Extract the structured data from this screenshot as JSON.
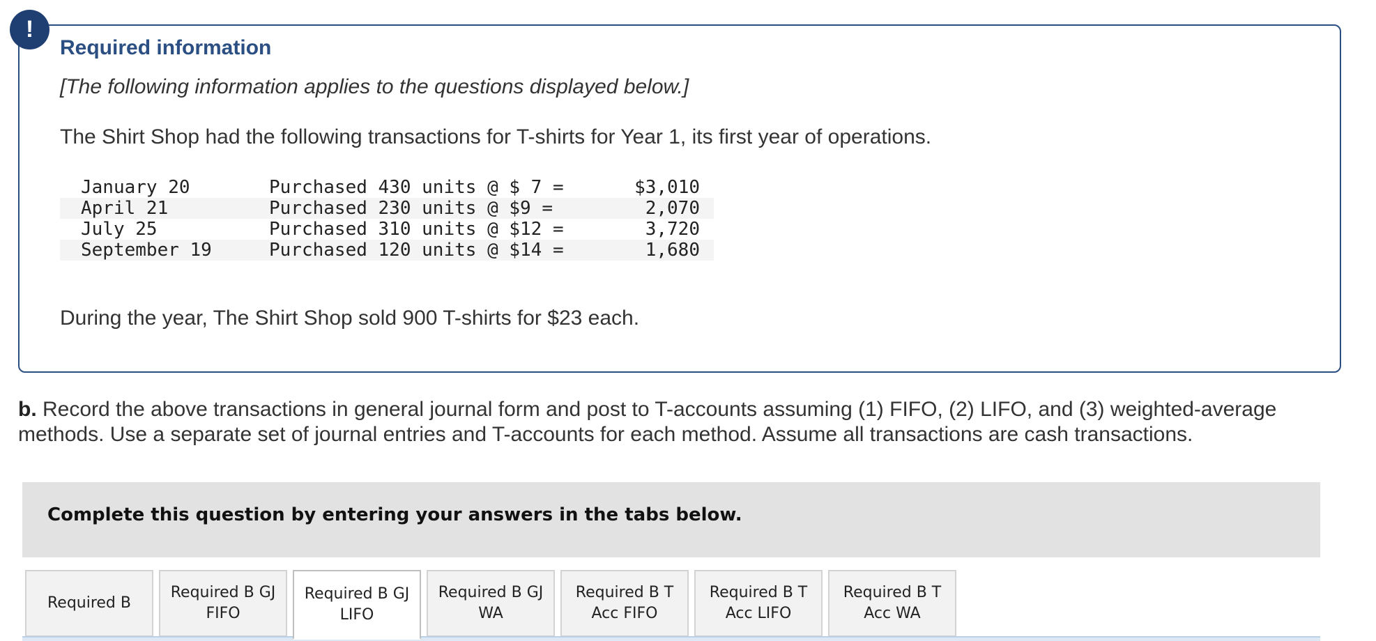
{
  "alert": {
    "icon": "exclamation-icon",
    "glyph": "!",
    "color": "#1f3f73"
  },
  "info": {
    "title": "Required information",
    "subtitle": "[The following information applies to the questions displayed below.]",
    "intro": "The Shirt Shop had the following transactions for T-shirts for Year 1, its first year of operations.",
    "transactions": [
      {
        "date": "January 20",
        "description": "Purchased 430 units @ $ 7 =",
        "amount": "$3,010"
      },
      {
        "date": "April 21",
        "description": "Purchased 230 units @ $9 =",
        "amount": "2,070"
      },
      {
        "date": "July 25",
        "description": "Purchased 310 units @ $12 =",
        "amount": "3,720"
      },
      {
        "date": "September 19",
        "description": "Purchased 120 units @ $14 =",
        "amount": "1,680"
      }
    ],
    "sold_text": "During the year, The Shirt Shop sold 900 T-shirts for $23 each."
  },
  "question": {
    "part": "b.",
    "text": "Record the above transactions in general journal form and post to T-accounts assuming (1) FIFO, (2) LIFO, and (3) weighted-average methods. Use a separate set of journal entries and T-accounts for each method. Assume all transactions are cash transactions."
  },
  "instructions": "Complete this question by entering your answers in the tabs below.",
  "tabs": [
    {
      "label": "Required B",
      "active": false
    },
    {
      "label": "Required B GJ\nFIFO",
      "active": false
    },
    {
      "label": "Required B GJ\nLIFO",
      "active": true
    },
    {
      "label": "Required B GJ\nWA",
      "active": false
    },
    {
      "label": "Required B T\nAcc FIFO",
      "active": false
    },
    {
      "label": "Required B T\nAcc LIFO",
      "active": false
    },
    {
      "label": "Required B T\nAcc WA",
      "active": false
    }
  ],
  "colors": {
    "accent": "#2b4f82",
    "instruction_bar": "#e2e2e2",
    "tab_background": "#f2f2f2",
    "tab_strip": "#dce8f4"
  }
}
